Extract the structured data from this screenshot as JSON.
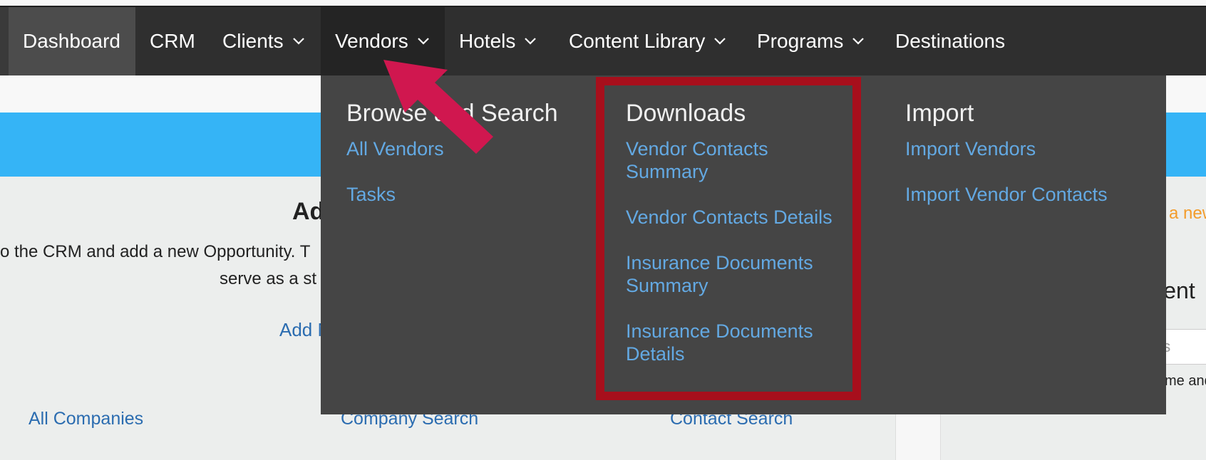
{
  "nav": {
    "items": [
      {
        "label": "Dashboard",
        "has_menu": false
      },
      {
        "label": "CRM",
        "has_menu": false
      },
      {
        "label": "Clients",
        "has_menu": true
      },
      {
        "label": "Vendors",
        "has_menu": true
      },
      {
        "label": "Hotels",
        "has_menu": true
      },
      {
        "label": "Content Library",
        "has_menu": true
      },
      {
        "label": "Programs",
        "has_menu": true
      },
      {
        "label": "Destinations",
        "has_menu": false
      }
    ],
    "active": "Dashboard",
    "open_menu": "Vendors"
  },
  "dropdown": {
    "columns": [
      {
        "title": "Browse and Search",
        "links": [
          "All Vendors",
          "Tasks"
        ]
      },
      {
        "title": "Downloads",
        "links": [
          "Vendor Contacts Summary",
          "Vendor Contacts Details",
          "Insurance Documents Summary",
          "Insurance Documents Details"
        ]
      },
      {
        "title": "Import",
        "links": [
          "Import Vendors",
          "Import Vendor Contacts"
        ]
      }
    ]
  },
  "background": {
    "heading_fragment": "Ad",
    "text_line1": "o the CRM and add a new Opportunity. T",
    "text_line2": "serve as a st",
    "link_add_fragment": "Add N",
    "bottom_links": [
      "All Companies",
      "Company Search",
      "Contact Search"
    ],
    "right_orange_fragment": "a new",
    "right_heading_fragment": "lient",
    "right_input_placeholder_fragment": "es",
    "right_small_fragment": "me and"
  },
  "colors": {
    "navbar": "#2f2f2f",
    "dropdown": "#454545",
    "link": "#63a9e3",
    "highlight": "#a70f1c",
    "arrow": "#d0174f",
    "banner": "#35b4f6"
  },
  "annotations": {
    "arrow_icon": "pointer-arrow-icon",
    "highlight_target": "Downloads"
  }
}
